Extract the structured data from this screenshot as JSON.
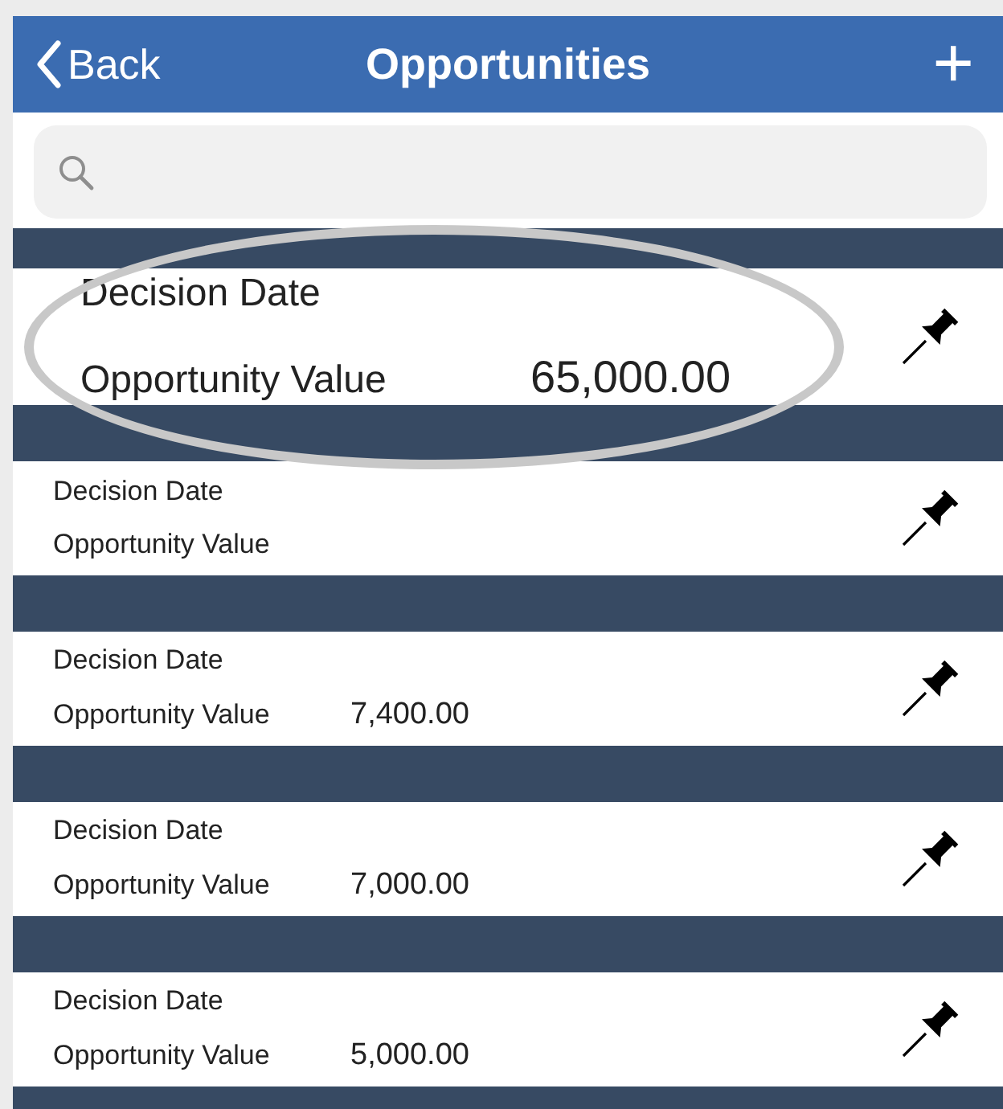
{
  "nav_bar": {
    "back_label": "Back",
    "title": "Opportunities",
    "add_label": "+"
  },
  "opportunities": [
    {
      "date_label": "Decision Date",
      "value_label": "Opportunity Value",
      "value": "65,000.00",
      "highlighted": true
    },
    {
      "date_label": "Decision Date",
      "value_label": "Opportunity Value",
      "highlighted": false
    },
    {
      "date_label": "Decision Date",
      "value_label": "Opportunity Value",
      "value": "7,400.00",
      "highlighted": false
    },
    {
      "date_label": "Decision Date",
      "value_label": "Opportunity Value",
      "value": "7,000.00",
      "highlighted": false
    },
    {
      "date_label": "Decision Date",
      "value_label": "Opportunity Value",
      "value": "5,000.00",
      "highlighted": false
    }
  ]
}
